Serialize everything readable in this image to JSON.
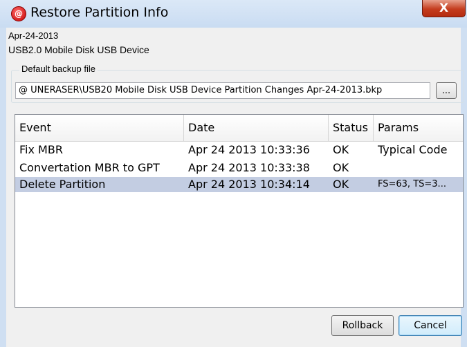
{
  "window": {
    "title": "Restore Partition Info",
    "app_icon": "app-logo-icon",
    "close_label": "X"
  },
  "info": {
    "date": "Apr-24-2013",
    "device": "USB2.0 Mobile Disk USB Device"
  },
  "backup": {
    "legend": "Default backup file",
    "path": "@ UNERASER\\USB20 Mobile Disk USB Device Partition Changes Apr-24-2013.bkp",
    "browse_label": "..."
  },
  "table": {
    "columns": [
      "Event",
      "Date",
      "Status",
      "Params"
    ],
    "rows": [
      {
        "event": "Fix MBR",
        "date": "Apr 24 2013 10:33:36",
        "status": "OK",
        "params": "Typical Code",
        "selected": false
      },
      {
        "event": "Convertation MBR to GPT",
        "date": "Apr 24 2013 10:33:38",
        "status": "OK",
        "params": "",
        "selected": false
      },
      {
        "event": "Delete Partition",
        "date": "Apr 24 2013 10:34:14",
        "status": "OK",
        "params": "FS=63, TS=3...",
        "selected": true
      }
    ]
  },
  "buttons": {
    "rollback": "Rollback",
    "cancel": "Cancel"
  },
  "colors": {
    "selection": "#c3cde2",
    "titlebar": "#dbe8f7",
    "close": "#c43c1e"
  }
}
